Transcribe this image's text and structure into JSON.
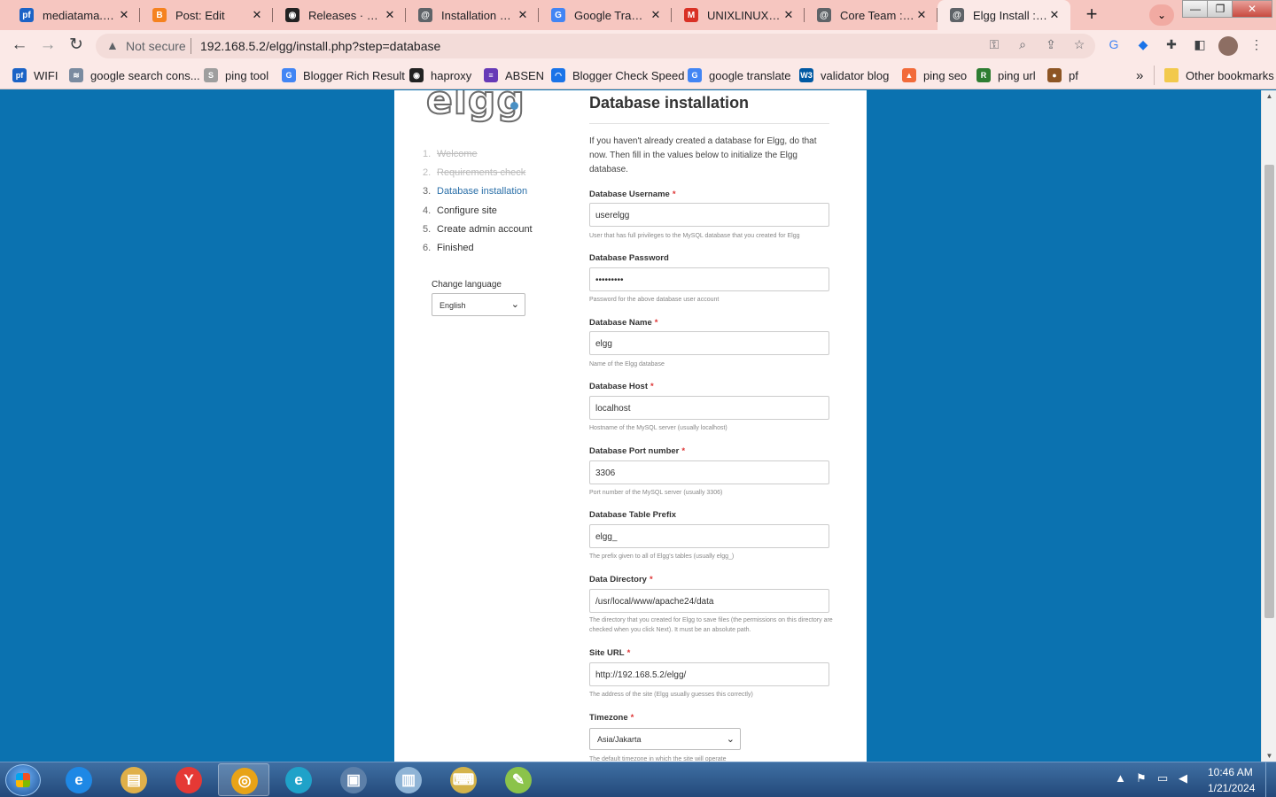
{
  "browser": {
    "tabs": [
      {
        "label": "mediatama.kurs",
        "icon": "pf-icon",
        "color": "#1b63c6",
        "glyph": "pf"
      },
      {
        "label": "Post: Edit",
        "icon": "blogger-icon",
        "color": "#f58220",
        "glyph": "B"
      },
      {
        "label": "Releases · Elgg/E",
        "icon": "github-icon",
        "color": "#222222",
        "glyph": "◉"
      },
      {
        "label": "Installation — El",
        "icon": "elgg-icon",
        "color": "#5f6368",
        "glyph": "@"
      },
      {
        "label": "Google Translat",
        "icon": "google-translate-icon",
        "color": "#4285f4",
        "glyph": "G"
      },
      {
        "label": "UNIXLINUXBSD",
        "icon": "gmail-icon",
        "color": "#d93025",
        "glyph": "M"
      },
      {
        "label": "Core Team : Elgg",
        "icon": "elgg-icon",
        "color": "#5f6368",
        "glyph": "@"
      },
      {
        "label": "Elgg Install : Dat",
        "icon": "elgg-icon",
        "color": "#5f6368",
        "glyph": "@",
        "active": true
      }
    ],
    "address": {
      "security_label": "Not secure",
      "url": "192.168.5.2/elgg/install.php?step=database"
    },
    "bookmarks": [
      {
        "label": "WIFI",
        "icon": "pf-icon",
        "color": "#1b63c6",
        "glyph": "pf"
      },
      {
        "label": "google search cons...",
        "icon": "search-console-icon",
        "color": "#7a8ba0",
        "glyph": "≋"
      },
      {
        "label": "ping tool",
        "icon": "sst-icon",
        "color": "#9e9e9e",
        "glyph": "S"
      },
      {
        "label": "Blogger Rich Result",
        "icon": "google-icon",
        "color": "#4285f4",
        "glyph": "G"
      },
      {
        "label": "haproxy",
        "icon": "github-icon",
        "color": "#222222",
        "glyph": "◉"
      },
      {
        "label": "ABSEN",
        "icon": "forms-icon",
        "color": "#673ab7",
        "glyph": "≡"
      },
      {
        "label": "Blogger Check Speed",
        "icon": "speed-icon",
        "color": "#1a73e8",
        "glyph": "◠"
      },
      {
        "label": "google translate",
        "icon": "google-translate-icon",
        "color": "#4285f4",
        "glyph": "G"
      },
      {
        "label": "validator blog",
        "icon": "w3c-icon",
        "color": "#0059a3",
        "glyph": "W3"
      },
      {
        "label": "ping seo",
        "icon": "rocket-icon",
        "color": "#f26b3a",
        "glyph": "▲"
      },
      {
        "label": "ping url",
        "icon": "pr-icon",
        "color": "#2e7d32",
        "glyph": "R"
      },
      {
        "label": "pf",
        "icon": "basketball-icon",
        "color": "#8d5524",
        "glyph": "●"
      }
    ],
    "more_bookmarks": "»",
    "other_bookmarks": "Other bookmarks"
  },
  "sidebar": {
    "steps": [
      {
        "num": "1.",
        "label": "Welcome",
        "state": "done"
      },
      {
        "num": "2.",
        "label": "Requirements check",
        "state": "done"
      },
      {
        "num": "3.",
        "label": "Database installation",
        "state": "current"
      },
      {
        "num": "4.",
        "label": "Configure site",
        "state": "todo"
      },
      {
        "num": "5.",
        "label": "Create admin account",
        "state": "todo"
      },
      {
        "num": "6.",
        "label": "Finished",
        "state": "todo"
      }
    ],
    "language_label": "Change language",
    "language_value": "English"
  },
  "main": {
    "logo_text": "elgg",
    "title": "Database installation",
    "intro": "If you haven't already created a database for Elgg, do that now. Then fill in the values below to initialize the Elgg database.",
    "fields": [
      {
        "label": "Database Username",
        "required": true,
        "value": "userelgg",
        "help": "User that has full privileges to the MySQL database that you created for Elgg"
      },
      {
        "label": "Database Password",
        "required": false,
        "value": "•••••••••",
        "help": "Password for the above database user account"
      },
      {
        "label": "Database Name",
        "required": true,
        "value": "elgg",
        "help": "Name of the Elgg database"
      },
      {
        "label": "Database Host",
        "required": true,
        "value": "localhost",
        "help": "Hostname of the MySQL server (usually localhost)"
      },
      {
        "label": "Database Port number",
        "required": true,
        "value": "3306",
        "help": "Port number of the MySQL server (usually 3306)"
      },
      {
        "label": "Database Table Prefix",
        "required": false,
        "value": "elgg_",
        "help": "The prefix given to all of Elgg's tables (usually elgg_)"
      },
      {
        "label": "Data Directory",
        "required": true,
        "value": "/usr/local/www/apache24/data",
        "help": "The directory that you created for Elgg to save files (the permissions on this directory are checked when you click Next). It must be an absolute path."
      },
      {
        "label": "Site URL",
        "required": true,
        "value": "http://192.168.5.2/elgg/",
        "help": "The address of the site (Elgg usually guesses this correctly)"
      }
    ],
    "timezone": {
      "label": "Timezone",
      "value": "Asia/Jakarta",
      "help": "The default timezone in which the site will operate"
    }
  },
  "taskbar": {
    "apps": [
      {
        "name": "ie-icon",
        "color": "#1e88e5",
        "glyph": "e"
      },
      {
        "name": "file-explorer-icon",
        "color": "#e0b04a",
        "glyph": "▤"
      },
      {
        "name": "yandex-icon",
        "color": "#e53935",
        "glyph": "Y"
      },
      {
        "name": "chrome-icon",
        "color": "#e8a317",
        "glyph": "◎",
        "active": true
      },
      {
        "name": "edge-icon",
        "color": "#1fa2c9",
        "glyph": "e"
      },
      {
        "name": "remote-desktop-icon",
        "color": "#5c7fa8",
        "glyph": "▣"
      },
      {
        "name": "notepad-icon",
        "color": "#8fb4d6",
        "glyph": "▥"
      },
      {
        "name": "putty-icon",
        "color": "#d4b34a",
        "glyph": "⌨"
      },
      {
        "name": "notepadpp-icon",
        "color": "#8bc34a",
        "glyph": "✎"
      }
    ],
    "time": "10:46 AM",
    "date": "1/21/2024"
  }
}
